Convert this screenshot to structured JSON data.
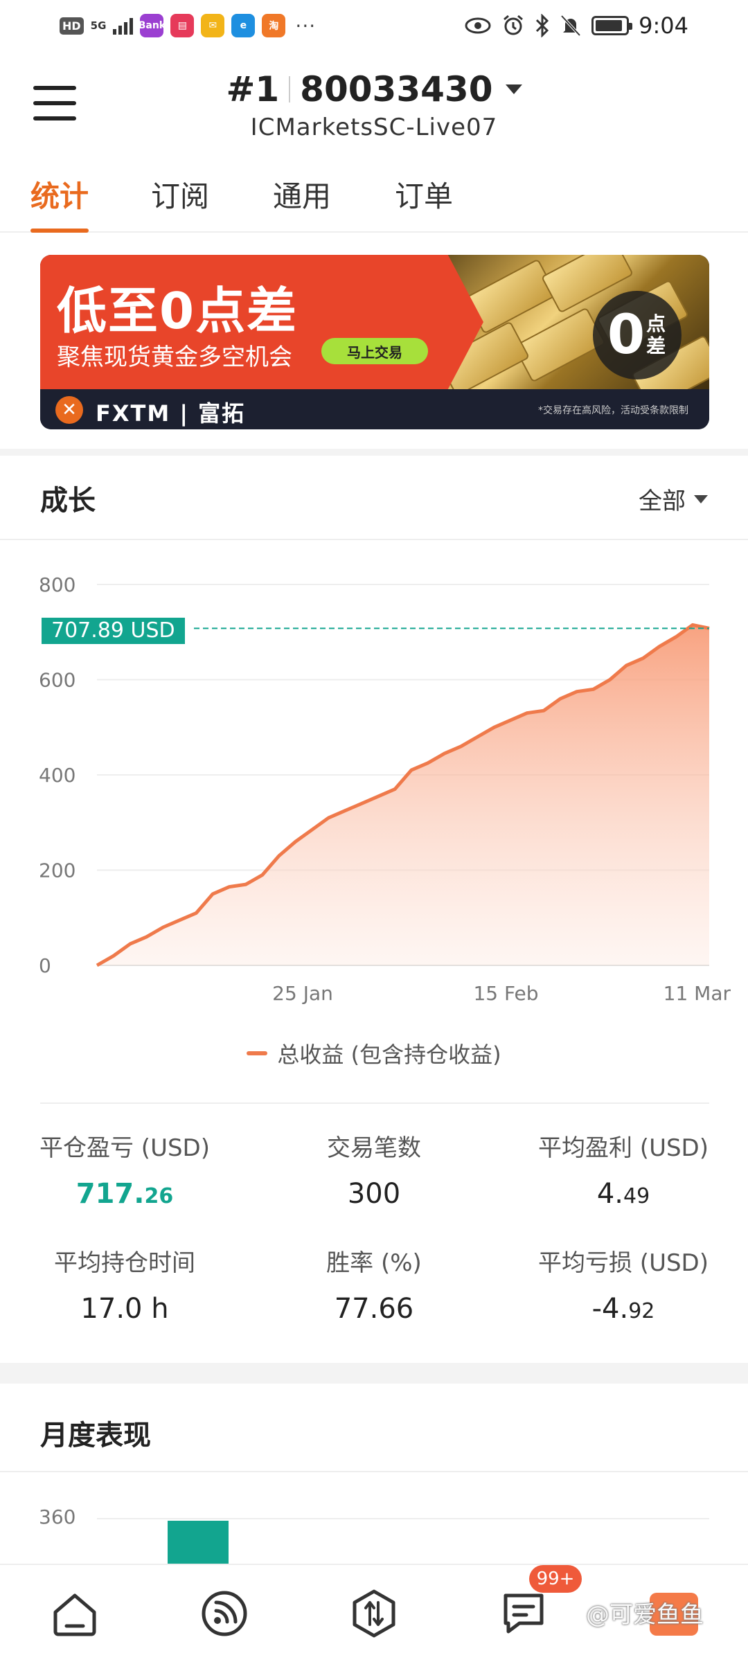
{
  "status_bar": {
    "hd": "HD",
    "network": "5G",
    "time": "9:04",
    "app_icons": [
      "Bank",
      "book",
      "mail",
      "e",
      "淘"
    ]
  },
  "header": {
    "account_rank": "#1",
    "account_number": "80033430",
    "server": "ICMarketsSC-Live07"
  },
  "tabs": [
    {
      "label": "统计",
      "active": true
    },
    {
      "label": "订阅",
      "active": false
    },
    {
      "label": "通用",
      "active": false
    },
    {
      "label": "订单",
      "active": false
    }
  ],
  "banner": {
    "headline": "低至0点差",
    "subline": "聚焦现货黄金多空机会",
    "cta": "马上交易",
    "badge_number": "0",
    "badge_text": "点差",
    "brand": "FXTM | 富拓",
    "disclaimer": "*交易存在高风险，活动受条款限制"
  },
  "growth": {
    "title": "成长",
    "range": "全部",
    "current_value_label": "707.89 USD",
    "legend": "总收益 (包含持仓收益)"
  },
  "chart_data": {
    "type": "area",
    "ylim": [
      0,
      800
    ],
    "yticks": [
      "800",
      "600",
      "400",
      "200",
      "0"
    ],
    "xtick_labels": [
      "25 Jan",
      "15 Feb",
      "11 Mar"
    ],
    "current_value": 707.89,
    "series": [
      {
        "name": "总收益 (包含持仓收益)",
        "color": "#ef7a4b",
        "values": [
          0,
          20,
          45,
          60,
          80,
          95,
          110,
          150,
          165,
          170,
          190,
          230,
          260,
          285,
          310,
          325,
          340,
          355,
          370,
          410,
          425,
          445,
          460,
          480,
          500,
          515,
          530,
          535,
          560,
          575,
          580,
          600,
          630,
          645,
          670,
          690,
          715,
          708
        ]
      }
    ]
  },
  "stats": [
    {
      "label": "平仓盈亏 (USD)",
      "value_main": "717.",
      "value_small": "26",
      "highlight": true
    },
    {
      "label": "交易笔数",
      "value_main": "300",
      "value_small": "",
      "highlight": false
    },
    {
      "label": "平均盈利 (USD)",
      "value_main": "4.",
      "value_small": "49",
      "highlight": false
    },
    {
      "label": "平均持仓时间",
      "value_main": "17.0 h",
      "value_small": "",
      "highlight": false
    },
    {
      "label": "胜率 (%)",
      "value_main": "77.66",
      "value_small": "",
      "highlight": false
    },
    {
      "label": "平均亏损 (USD)",
      "value_main": "-4.",
      "value_small": "92",
      "highlight": false
    }
  ],
  "monthly": {
    "title": "月度表现",
    "axis_label": "360"
  },
  "bottom_nav": {
    "badge": "99+",
    "watermark": "@可爱鱼鱼",
    "items": [
      "home-icon",
      "signal-icon",
      "trade-icon",
      "message-icon",
      "profile-icon"
    ]
  }
}
